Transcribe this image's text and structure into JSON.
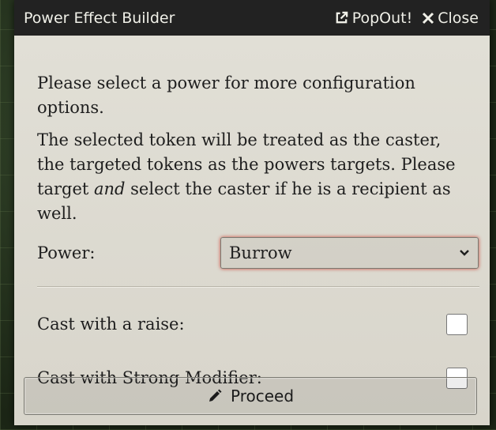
{
  "window": {
    "title": "Power Effect Builder",
    "popout_label": "PopOut!",
    "close_label": "Close"
  },
  "intro": {
    "line1": "Please select a power for more configuration options.",
    "line2_part1": "The selected token will be treated as the caster, the targeted tokens as the powers targets. Please target ",
    "line2_emphasis": "and",
    "line2_part2": " select the caster if he is a recipient as well."
  },
  "power": {
    "label": "Power:",
    "selected": "Burrow"
  },
  "options": {
    "raise_label": "Cast with a raise:",
    "raise_checked": false,
    "strong_label": "Cast with Strong Modifier:",
    "strong_checked": false
  },
  "footer": {
    "proceed_label": "Proceed"
  },
  "icons": {
    "popout": "external-link-icon",
    "close": "times-icon",
    "select": "chevron-down-icon",
    "proceed": "pencil-icon"
  }
}
